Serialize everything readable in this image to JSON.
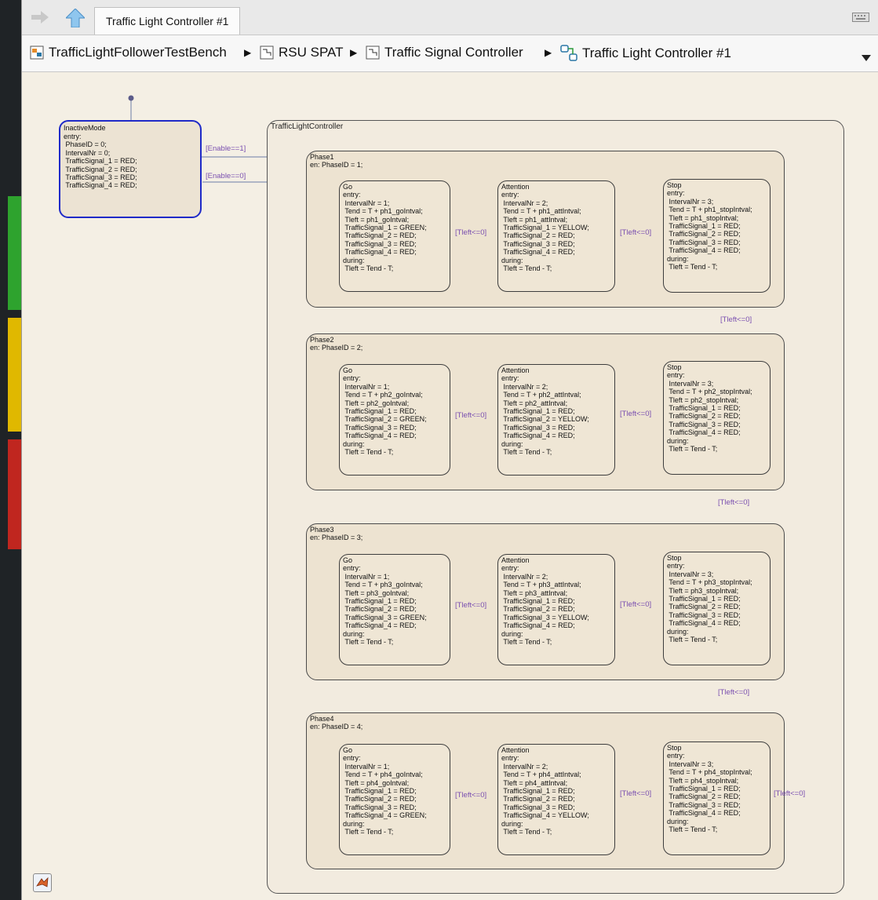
{
  "window": {
    "tab_label": "Traffic Light Controller #1"
  },
  "breadcrumb": {
    "items": [
      "TrafficLightFollowerTestBench",
      "RSU SPAT",
      "Traffic Signal Controller",
      "Traffic Light Controller #1"
    ]
  },
  "chart": {
    "inactive": {
      "title": "InactiveMode",
      "body": "entry:\n PhaseID = 0;\n IntervalNr = 0;\n TrafficSignal_1 = RED;\n TrafficSignal_2 = RED;\n TrafficSignal_3 = RED;\n TrafficSignal_4 = RED;"
    },
    "enable_on_label": "[Enable==1]",
    "enable_off_label": "[Enable==0]",
    "outer_title": "TrafficLightController",
    "transition_label": "[Tleft<=0]",
    "phases": [
      {
        "title": "Phase1\nen: PhaseID = 1;",
        "go": "Go\nentry:\n IntervalNr = 1;\n Tend = T + ph1_goIntval;\n Tleft = ph1_goIntval;\n TrafficSignal_1 = GREEN;\n TrafficSignal_2 = RED;\n TrafficSignal_3 = RED;\n TrafficSignal_4 = RED;\nduring:\n Tleft = Tend - T;",
        "attention": "Attention\nentry:\n IntervalNr = 2;\n Tend = T + ph1_attIntval;\n Tleft = ph1_attIntval;\n TrafficSignal_1 = YELLOW;\n TrafficSignal_2 = RED;\n TrafficSignal_3 = RED;\n TrafficSignal_4 = RED;\nduring:\n Tleft = Tend - T;",
        "stop": "Stop\nentry:\n IntervalNr = 3;\n Tend = T + ph1_stopIntval;\n Tleft = ph1_stopIntval;\n TrafficSignal_1 = RED;\n TrafficSignal_2 = RED;\n TrafficSignal_3 = RED;\n TrafficSignal_4 = RED;\nduring:\n Tleft = Tend - T;"
      },
      {
        "title": "Phase2\nen: PhaseID = 2;",
        "go": "Go\nentry:\n IntervalNr = 1;\n Tend = T + ph2_goIntval;\n Tleft = ph2_goIntval;\n TrafficSignal_1 = RED;\n TrafficSignal_2 = GREEN;\n TrafficSignal_3 = RED;\n TrafficSignal_4 = RED;\nduring:\n Tleft = Tend - T;",
        "attention": "Attention\nentry:\n IntervalNr = 2;\n Tend = T + ph2_attIntval;\n Tleft = ph2_attIntval;\n TrafficSignal_1 = RED;\n TrafficSignal_2 = YELLOW;\n TrafficSignal_3 = RED;\n TrafficSignal_4 = RED;\nduring:\n Tleft = Tend - T;",
        "stop": "Stop\nentry:\n IntervalNr = 3;\n Tend = T + ph2_stopIntval;\n Tleft = ph2_stopIntval;\n TrafficSignal_1 = RED;\n TrafficSignal_2 = RED;\n TrafficSignal_3 = RED;\n TrafficSignal_4 = RED;\nduring:\n Tleft = Tend - T;"
      },
      {
        "title": "Phase3\nen: PhaseID = 3;",
        "go": "Go\nentry:\n IntervalNr = 1;\n Tend = T + ph3_goIntval;\n Tleft = ph3_goIntval;\n TrafficSignal_1 = RED;\n TrafficSignal_2 = RED;\n TrafficSignal_3 = GREEN;\n TrafficSignal_4 = RED;\nduring:\n Tleft = Tend - T;",
        "attention": "Attention\nentry:\n IntervalNr = 2;\n Tend = T + ph3_attIntval;\n Tleft = ph3_attIntval;\n TrafficSignal_1 = RED;\n TrafficSignal_2 = RED;\n TrafficSignal_3 = YELLOW;\n TrafficSignal_4 = RED;\nduring:\n Tleft = Tend - T;",
        "stop": "Stop\nentry:\n IntervalNr = 3;\n Tend = T + ph3_stopIntval;\n Tleft = ph3_stopIntval;\n TrafficSignal_1 = RED;\n TrafficSignal_2 = RED;\n TrafficSignal_3 = RED;\n TrafficSignal_4 = RED;\nduring:\n Tleft = Tend - T;"
      },
      {
        "title": "Phase4\nen: PhaseID = 4;",
        "go": "Go\nentry:\n IntervalNr = 1;\n Tend = T + ph4_goIntval;\n Tleft = ph4_goIntval;\n TrafficSignal_1 = RED;\n TrafficSignal_2 = RED;\n TrafficSignal_3 = RED;\n TrafficSignal_4 = GREEN;\nduring:\n Tleft = Tend - T;",
        "attention": "Attention\nentry:\n IntervalNr = 2;\n Tend = T + ph4_attIntval;\n Tleft = ph4_attIntval;\n TrafficSignal_1 = RED;\n TrafficSignal_2 = RED;\n TrafficSignal_3 = RED;\n TrafficSignal_4 = YELLOW;\nduring:\n Tleft = Tend - T;",
        "stop": "Stop\nentry:\n IntervalNr = 3;\n Tend = T + ph4_stopIntval;\n Tleft = ph4_stopIntval;\n TrafficSignal_1 = RED;\n TrafficSignal_2 = RED;\n TrafficSignal_3 = RED;\n TrafficSignal_4 = RED;\nduring:\n Tleft = Tend - T;"
      }
    ]
  },
  "icons": {
    "back": "back-arrow-icon",
    "up": "up-arrow-icon",
    "keyboard": "keyboard-icon",
    "subsystem": "subsystem-icon",
    "chart": "stateflow-chart-icon",
    "dropdown": "dropdown-icon",
    "matlab": "matlab-icon"
  },
  "colors": {
    "canvas": "#f4efe4",
    "state_border": "#3d3d3d",
    "selected_border": "#1f2ac8",
    "label": "#7a4fb0",
    "arrow": "#2a77a6"
  }
}
